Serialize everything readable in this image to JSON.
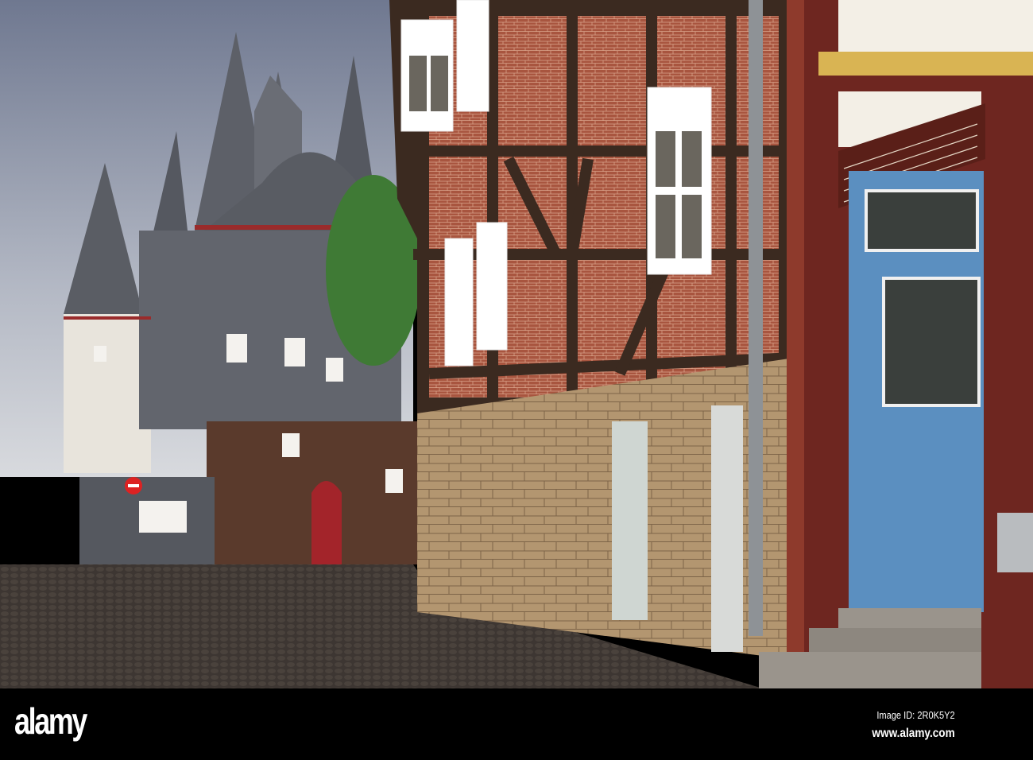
{
  "watermark": {
    "logo": "alamy",
    "image_id": "Image ID: 2R0K5Y2",
    "url": "www.alamy.com"
  },
  "colors": {
    "sky": "#8c95a8",
    "slate": "#5d6068",
    "brick": "#a4523c",
    "timber": "#3f2a1e",
    "sandstone": "#b89a72",
    "red_house": "#7a2a22",
    "door_blue": "#5b8fc0",
    "cobble": "#3a3430"
  }
}
